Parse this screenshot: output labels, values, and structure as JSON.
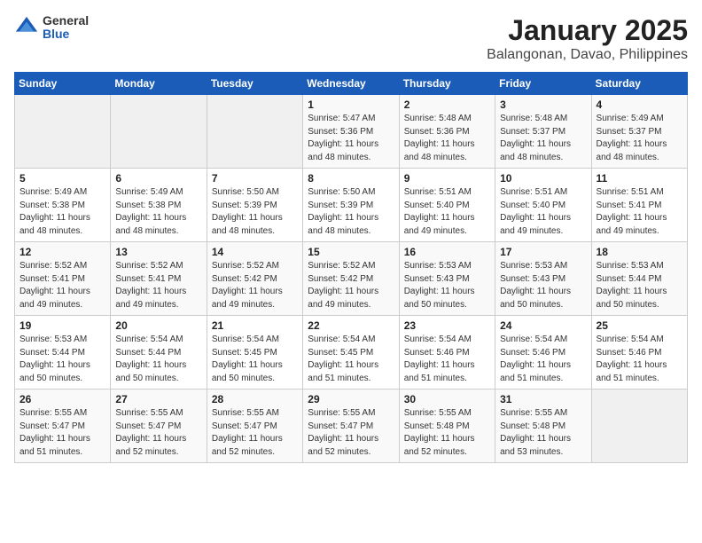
{
  "header": {
    "logo_general": "General",
    "logo_blue": "Blue",
    "title": "January 2025",
    "subtitle": "Balangonan, Davao, Philippines"
  },
  "days_of_week": [
    "Sunday",
    "Monday",
    "Tuesday",
    "Wednesday",
    "Thursday",
    "Friday",
    "Saturday"
  ],
  "weeks": [
    [
      {
        "num": "",
        "detail": ""
      },
      {
        "num": "",
        "detail": ""
      },
      {
        "num": "",
        "detail": ""
      },
      {
        "num": "1",
        "detail": "Sunrise: 5:47 AM\nSunset: 5:36 PM\nDaylight: 11 hours\nand 48 minutes."
      },
      {
        "num": "2",
        "detail": "Sunrise: 5:48 AM\nSunset: 5:36 PM\nDaylight: 11 hours\nand 48 minutes."
      },
      {
        "num": "3",
        "detail": "Sunrise: 5:48 AM\nSunset: 5:37 PM\nDaylight: 11 hours\nand 48 minutes."
      },
      {
        "num": "4",
        "detail": "Sunrise: 5:49 AM\nSunset: 5:37 PM\nDaylight: 11 hours\nand 48 minutes."
      }
    ],
    [
      {
        "num": "5",
        "detail": "Sunrise: 5:49 AM\nSunset: 5:38 PM\nDaylight: 11 hours\nand 48 minutes."
      },
      {
        "num": "6",
        "detail": "Sunrise: 5:49 AM\nSunset: 5:38 PM\nDaylight: 11 hours\nand 48 minutes."
      },
      {
        "num": "7",
        "detail": "Sunrise: 5:50 AM\nSunset: 5:39 PM\nDaylight: 11 hours\nand 48 minutes."
      },
      {
        "num": "8",
        "detail": "Sunrise: 5:50 AM\nSunset: 5:39 PM\nDaylight: 11 hours\nand 48 minutes."
      },
      {
        "num": "9",
        "detail": "Sunrise: 5:51 AM\nSunset: 5:40 PM\nDaylight: 11 hours\nand 49 minutes."
      },
      {
        "num": "10",
        "detail": "Sunrise: 5:51 AM\nSunset: 5:40 PM\nDaylight: 11 hours\nand 49 minutes."
      },
      {
        "num": "11",
        "detail": "Sunrise: 5:51 AM\nSunset: 5:41 PM\nDaylight: 11 hours\nand 49 minutes."
      }
    ],
    [
      {
        "num": "12",
        "detail": "Sunrise: 5:52 AM\nSunset: 5:41 PM\nDaylight: 11 hours\nand 49 minutes."
      },
      {
        "num": "13",
        "detail": "Sunrise: 5:52 AM\nSunset: 5:41 PM\nDaylight: 11 hours\nand 49 minutes."
      },
      {
        "num": "14",
        "detail": "Sunrise: 5:52 AM\nSunset: 5:42 PM\nDaylight: 11 hours\nand 49 minutes."
      },
      {
        "num": "15",
        "detail": "Sunrise: 5:52 AM\nSunset: 5:42 PM\nDaylight: 11 hours\nand 49 minutes."
      },
      {
        "num": "16",
        "detail": "Sunrise: 5:53 AM\nSunset: 5:43 PM\nDaylight: 11 hours\nand 50 minutes."
      },
      {
        "num": "17",
        "detail": "Sunrise: 5:53 AM\nSunset: 5:43 PM\nDaylight: 11 hours\nand 50 minutes."
      },
      {
        "num": "18",
        "detail": "Sunrise: 5:53 AM\nSunset: 5:44 PM\nDaylight: 11 hours\nand 50 minutes."
      }
    ],
    [
      {
        "num": "19",
        "detail": "Sunrise: 5:53 AM\nSunset: 5:44 PM\nDaylight: 11 hours\nand 50 minutes."
      },
      {
        "num": "20",
        "detail": "Sunrise: 5:54 AM\nSunset: 5:44 PM\nDaylight: 11 hours\nand 50 minutes."
      },
      {
        "num": "21",
        "detail": "Sunrise: 5:54 AM\nSunset: 5:45 PM\nDaylight: 11 hours\nand 50 minutes."
      },
      {
        "num": "22",
        "detail": "Sunrise: 5:54 AM\nSunset: 5:45 PM\nDaylight: 11 hours\nand 51 minutes."
      },
      {
        "num": "23",
        "detail": "Sunrise: 5:54 AM\nSunset: 5:46 PM\nDaylight: 11 hours\nand 51 minutes."
      },
      {
        "num": "24",
        "detail": "Sunrise: 5:54 AM\nSunset: 5:46 PM\nDaylight: 11 hours\nand 51 minutes."
      },
      {
        "num": "25",
        "detail": "Sunrise: 5:54 AM\nSunset: 5:46 PM\nDaylight: 11 hours\nand 51 minutes."
      }
    ],
    [
      {
        "num": "26",
        "detail": "Sunrise: 5:55 AM\nSunset: 5:47 PM\nDaylight: 11 hours\nand 51 minutes."
      },
      {
        "num": "27",
        "detail": "Sunrise: 5:55 AM\nSunset: 5:47 PM\nDaylight: 11 hours\nand 52 minutes."
      },
      {
        "num": "28",
        "detail": "Sunrise: 5:55 AM\nSunset: 5:47 PM\nDaylight: 11 hours\nand 52 minutes."
      },
      {
        "num": "29",
        "detail": "Sunrise: 5:55 AM\nSunset: 5:47 PM\nDaylight: 11 hours\nand 52 minutes."
      },
      {
        "num": "30",
        "detail": "Sunrise: 5:55 AM\nSunset: 5:48 PM\nDaylight: 11 hours\nand 52 minutes."
      },
      {
        "num": "31",
        "detail": "Sunrise: 5:55 AM\nSunset: 5:48 PM\nDaylight: 11 hours\nand 53 minutes."
      },
      {
        "num": "",
        "detail": ""
      }
    ]
  ]
}
